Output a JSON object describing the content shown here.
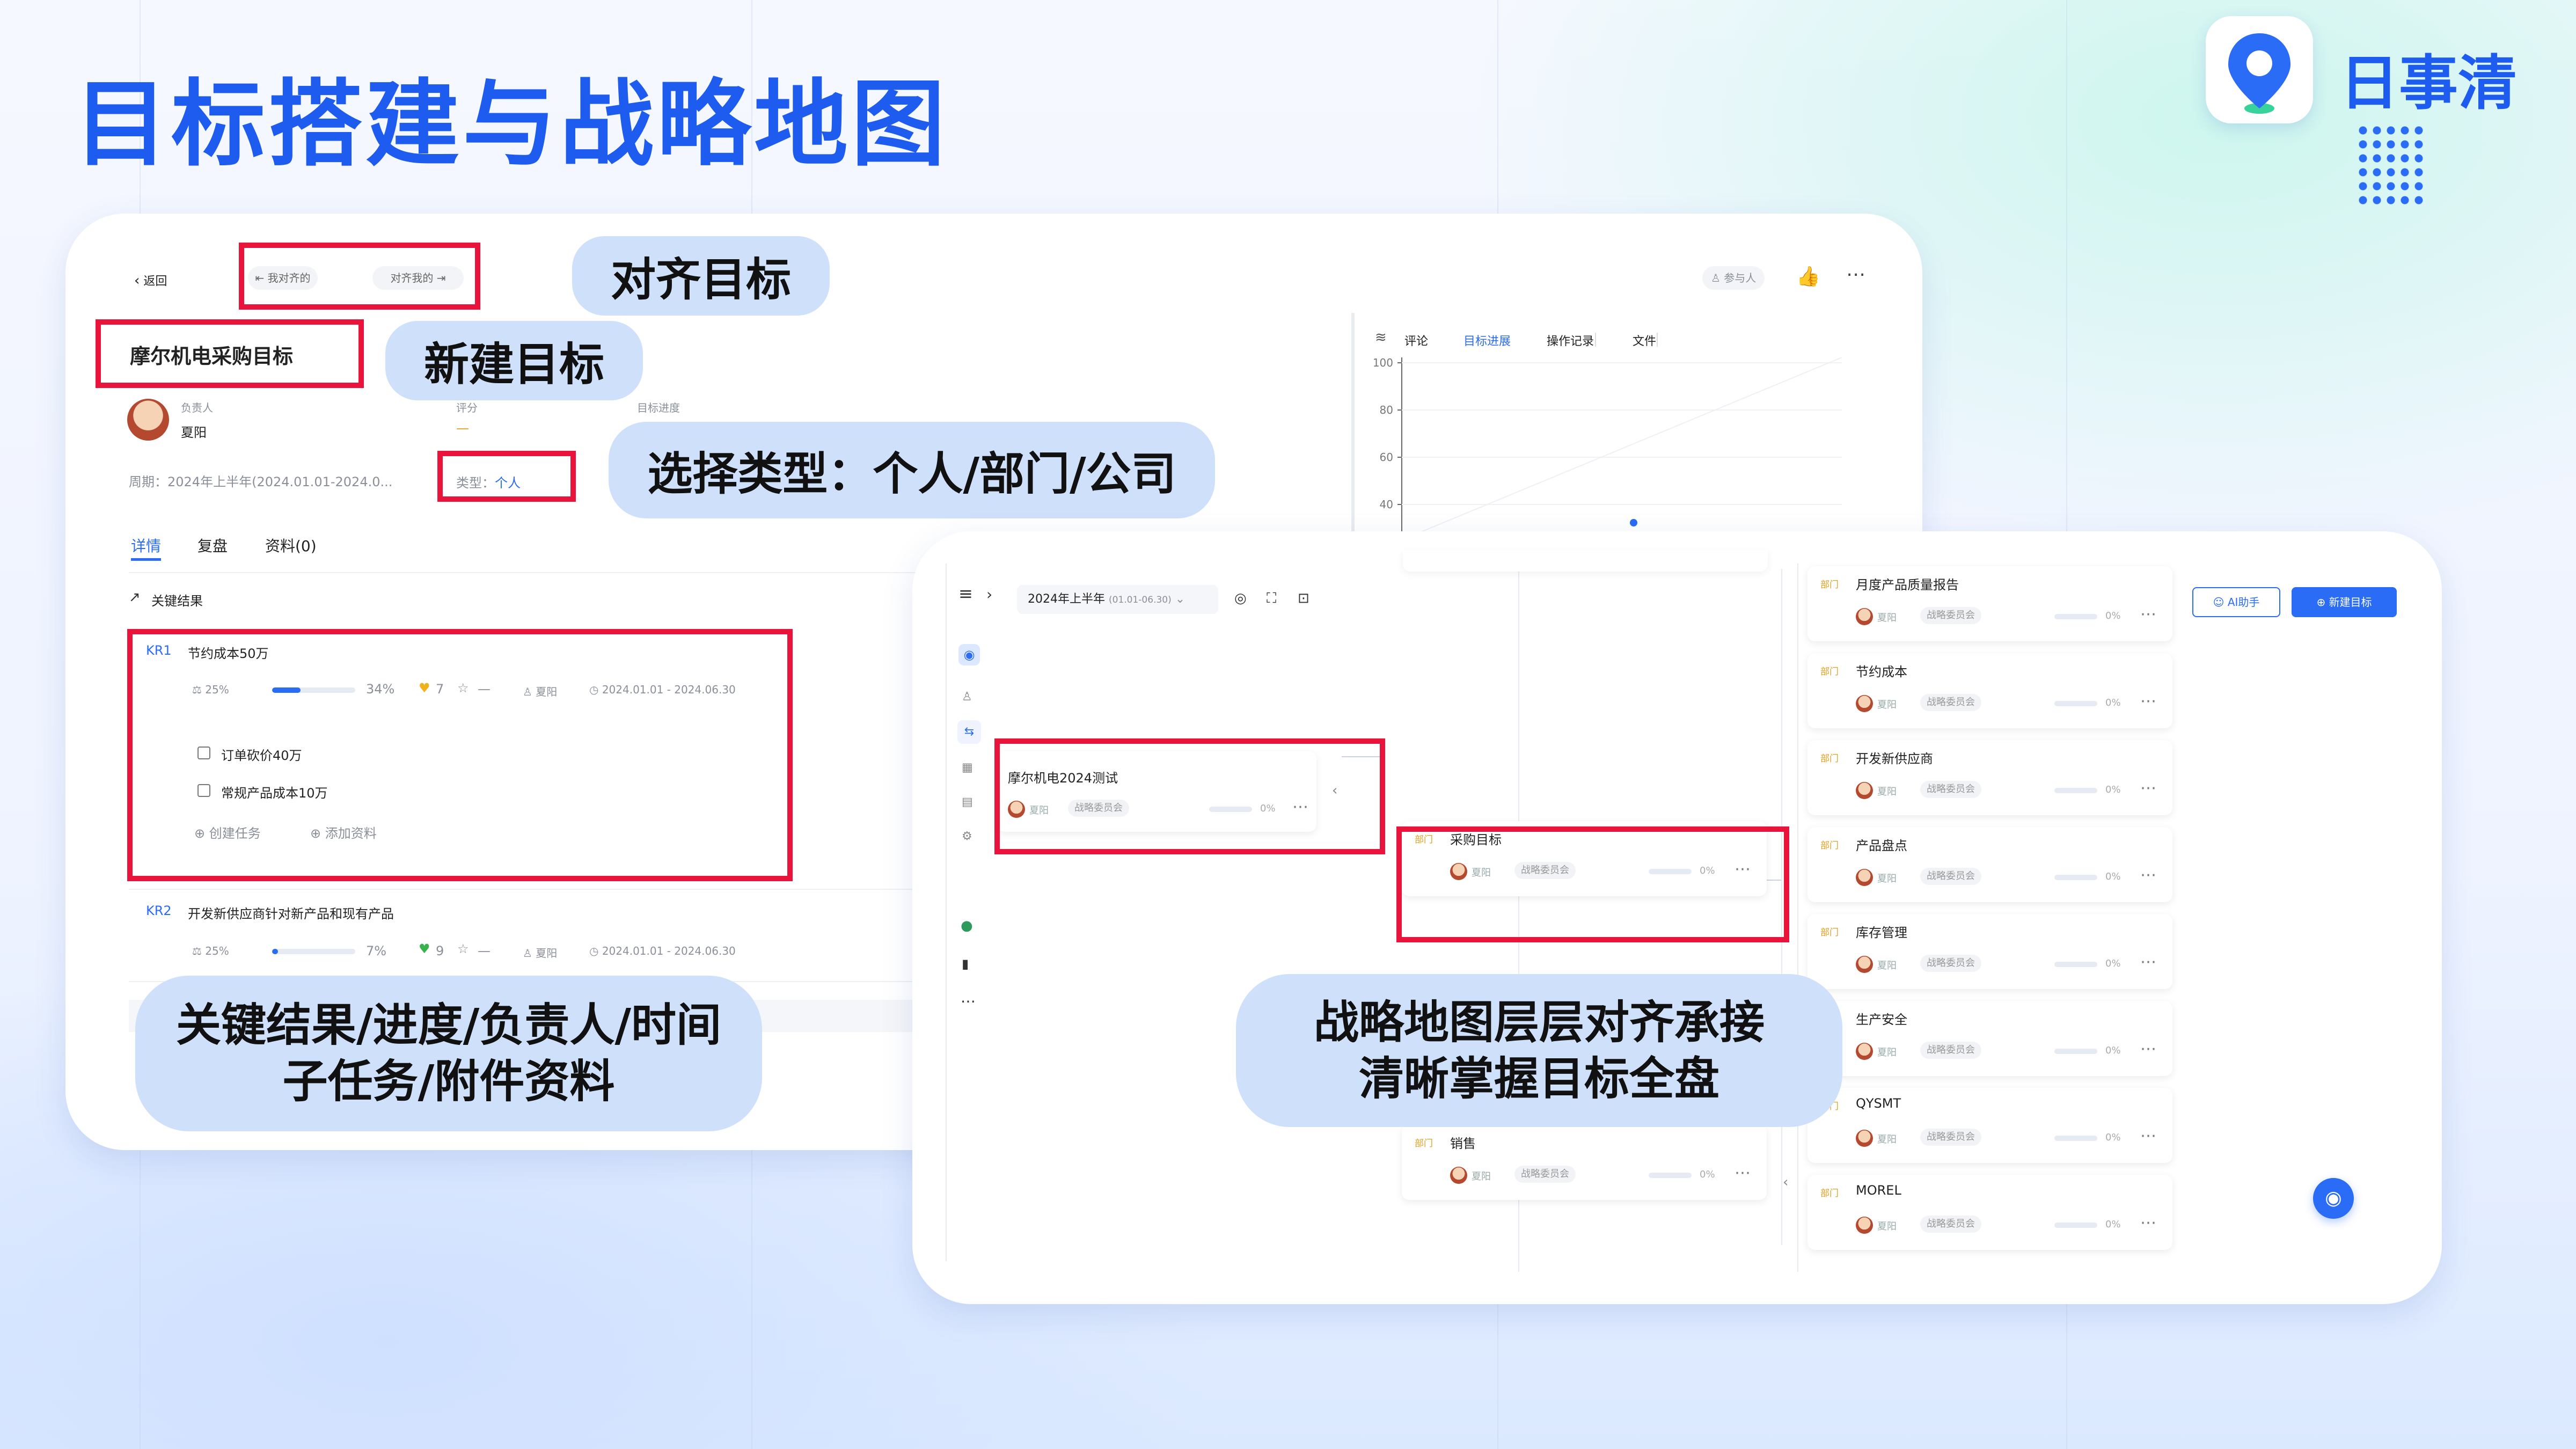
{
  "page": {
    "title": "目标搭建与战略地图",
    "brand": "日事清"
  },
  "callouts": {
    "align": "对齐目标",
    "new_goal": "新建目标",
    "type": "选择类型：个人/部门/公司",
    "kr_line1": "关键结果/进度/负责人/时间",
    "kr_line2": "子任务/附件资料",
    "map_line1": "战略地图层层对齐承接",
    "map_line2": "清晰掌握目标全盘"
  },
  "goal_detail": {
    "back": "返回",
    "aligned_to_me": "我对齐的",
    "align_mine": "对齐我的",
    "participants": "参与人",
    "goal_name": "摩尔机电采购目标",
    "owner_label": "负责人",
    "owner": "夏阳",
    "score_label": "评分",
    "score": "—",
    "progress_label": "目标进度",
    "period": "周期：2024年上半年(2024.01.01-2024.0...",
    "type_label": "类型：",
    "type_value": "个人",
    "tabs": [
      "详情",
      "复盘",
      "资料(0)"
    ],
    "side_tabs": [
      "评论",
      "目标进展",
      "操作记录",
      "文件"
    ],
    "chart_ticks": [
      "100",
      "80",
      "60",
      "40"
    ],
    "section": "关键结果",
    "kr1": {
      "code": "KR1",
      "title": "节约成本50万",
      "weight": "25%",
      "progress": 34,
      "progress_text": "34%",
      "likes": "7",
      "star": "—",
      "owner": "夏阳",
      "dates": "2024.01.01 - 2024.06.30",
      "subtasks": [
        "订单砍价40万",
        "常规产品成本10万"
      ],
      "create_task": "创建任务",
      "add_doc": "添加资料"
    },
    "kr2": {
      "code": "KR2",
      "title": "开发新供应商针对新产品和现有产品",
      "weight": "25%",
      "progress": 7,
      "progress_text": "7%",
      "likes": "9",
      "star": "—",
      "owner": "夏阳",
      "dates": "2024.01.01 - 2024.06.30"
    }
  },
  "strategy_map": {
    "period": "2024年上半年",
    "period_range": "(01.01-06.30)",
    "ai_button": "AI助手",
    "new_goal_button": "新建目标",
    "root": {
      "name": "摩尔机电2024测试",
      "owner": "夏阳",
      "group": "战略委员会",
      "progress": "0%"
    },
    "mid": [
      {
        "tag": "部门",
        "name": "采购目标",
        "owner": "夏阳",
        "group": "战略委员会",
        "progress": "0%"
      },
      {
        "tag": "部门",
        "name": "销售",
        "owner": "夏阳",
        "group": "战略委员会",
        "progress": "0%"
      }
    ],
    "leaves": [
      {
        "tag": "部门",
        "name": "月度产品质量报告",
        "owner": "夏阳",
        "group": "战略委员会",
        "progress": "0%"
      },
      {
        "tag": "部门",
        "name": "节约成本",
        "owner": "夏阳",
        "group": "战略委员会",
        "progress": "0%"
      },
      {
        "tag": "部门",
        "name": "开发新供应商",
        "owner": "夏阳",
        "group": "战略委员会",
        "progress": "0%"
      },
      {
        "tag": "部门",
        "name": "产品盘点",
        "owner": "夏阳",
        "group": "战略委员会",
        "progress": "0%"
      },
      {
        "tag": "部门",
        "name": "库存管理",
        "owner": "夏阳",
        "group": "战略委员会",
        "progress": "0%"
      },
      {
        "tag": "部门",
        "name": "生产安全",
        "owner": "夏阳",
        "group": "战略委员会",
        "progress": "0%"
      },
      {
        "tag": "部门",
        "name": "QYSMT",
        "owner": "夏阳",
        "group": "战略委员会",
        "progress": "0%"
      },
      {
        "tag": "部门",
        "name": "MOREL",
        "owner": "夏阳",
        "group": "战略委员会",
        "progress": "0%"
      }
    ]
  },
  "colors": {
    "accent": "#1e5cf0",
    "highlight": "#e8143c",
    "callout": "#cfe0fb"
  }
}
